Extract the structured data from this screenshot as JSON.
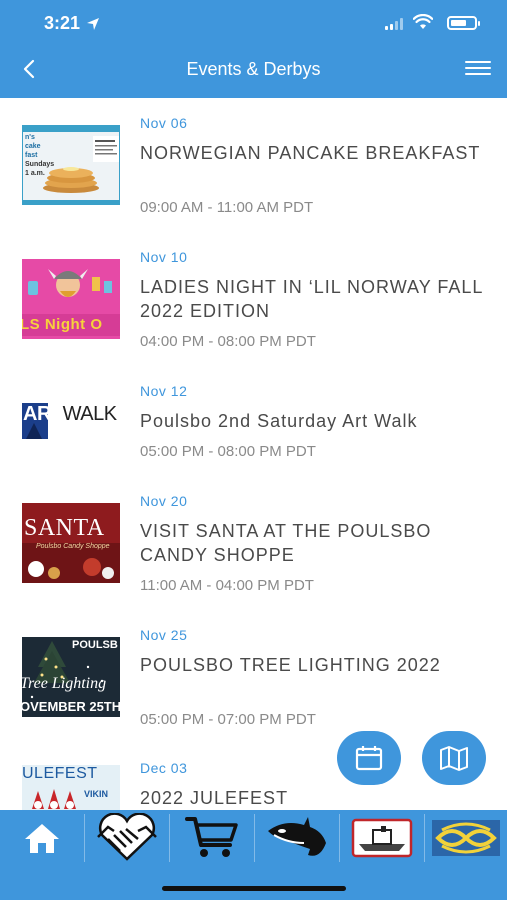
{
  "status_bar": {
    "time": "3:21"
  },
  "header": {
    "title": "Events & Derbys"
  },
  "events": [
    {
      "date": "Nov 06",
      "title": "NORWEGIAN PANCAKE BREAKFAST",
      "time": "09:00 AM - 11:00 AM PDT"
    },
    {
      "date": "Nov 10",
      "title": "LADIES NIGHT IN ‘LIL NORWAY FALL 2022 EDITION",
      "time": "04:00 PM - 08:00 PM PDT"
    },
    {
      "date": "Nov 12",
      "title": "Poulsbo 2nd Saturday Art Walk",
      "time": "05:00 PM - 08:00 PM PDT"
    },
    {
      "date": "Nov 20",
      "title": "VISIT SANTA AT THE POULSBO CANDY SHOPPE",
      "time": "11:00 AM - 04:00 PM PDT"
    },
    {
      "date": "Nov 25",
      "title": "POULSBO TREE LIGHTING 2022",
      "time": "05:00 PM - 07:00 PM PDT"
    },
    {
      "date": "Dec 03",
      "title": "2022 JULEFEST",
      "time": ""
    }
  ],
  "thumbnails": {
    "pancake": {
      "line1": "n's",
      "line2": "cake",
      "line3": "fast",
      "line4": "Sundays",
      "line5": "1 a.m."
    },
    "ladies": {
      "text": "LS Night O"
    },
    "artwalk": {
      "text1": "ART",
      "text2": "WALK"
    },
    "santa": {
      "text1": "SANTA",
      "text2": "Poulsbo Candy Shoppe"
    },
    "tree": {
      "text1": "POULSB",
      "text2": "Tree Lighting",
      "text3": "OVEMBER 25TH"
    },
    "julefest": {
      "text1": "ULEFEST",
      "text2": "VIKIN"
    }
  },
  "colors": {
    "primary": "#3f96dc",
    "date": "#3f96dc",
    "title": "#4a4a4a",
    "time": "#8a8a8a"
  },
  "fabs": [
    {
      "icon": "calendar-icon"
    },
    {
      "icon": "map-icon"
    }
  ],
  "tabs": [
    {
      "icon": "home-icon"
    },
    {
      "icon": "handshake-icon"
    },
    {
      "icon": "cart-icon"
    },
    {
      "icon": "orca-icon"
    },
    {
      "icon": "ferry-icon"
    },
    {
      "icon": "knot-icon"
    }
  ]
}
